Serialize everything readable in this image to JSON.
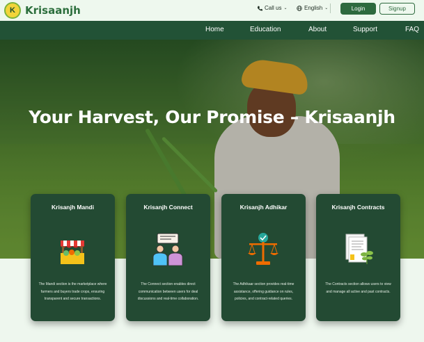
{
  "header": {
    "logo_text": "Krisaanjh",
    "call_label": "Call us",
    "language_label": "English",
    "login_label": "Login",
    "signup_label": "Signup"
  },
  "nav": {
    "items": [
      "Home",
      "Education",
      "About",
      "Support",
      "FAQ"
    ]
  },
  "hero": {
    "title": "Your Harvest, Our Promise – Krisaanjh"
  },
  "cards": [
    {
      "title": "Krisanjh Mandi",
      "icon": "market-stall-icon",
      "description": "The Mandi section is the marketplace where farmers and buyers trade crops, ensuring transparent and secure transactions."
    },
    {
      "title": "Krisanjh Connect",
      "icon": "people-chat-icon",
      "description": "The Connect section enables direct communication between users for deal discussions and real-time collaboration."
    },
    {
      "title": "Krisanjh Adhikar",
      "icon": "justice-scale-icon",
      "description": "The Adhikaar section provides real-time assistance, offering guidance on rules, policies, and contract-related queries."
    },
    {
      "title": "Krisanjh Contracts",
      "icon": "contract-document-icon",
      "description": "The Contracts section allows users to view and manage all active and past contracts."
    }
  ],
  "colors": {
    "brand_green": "#2d6a3e",
    "nav_bg": "#225236",
    "card_bg": "#234a33",
    "page_bg": "#eef7ee"
  }
}
